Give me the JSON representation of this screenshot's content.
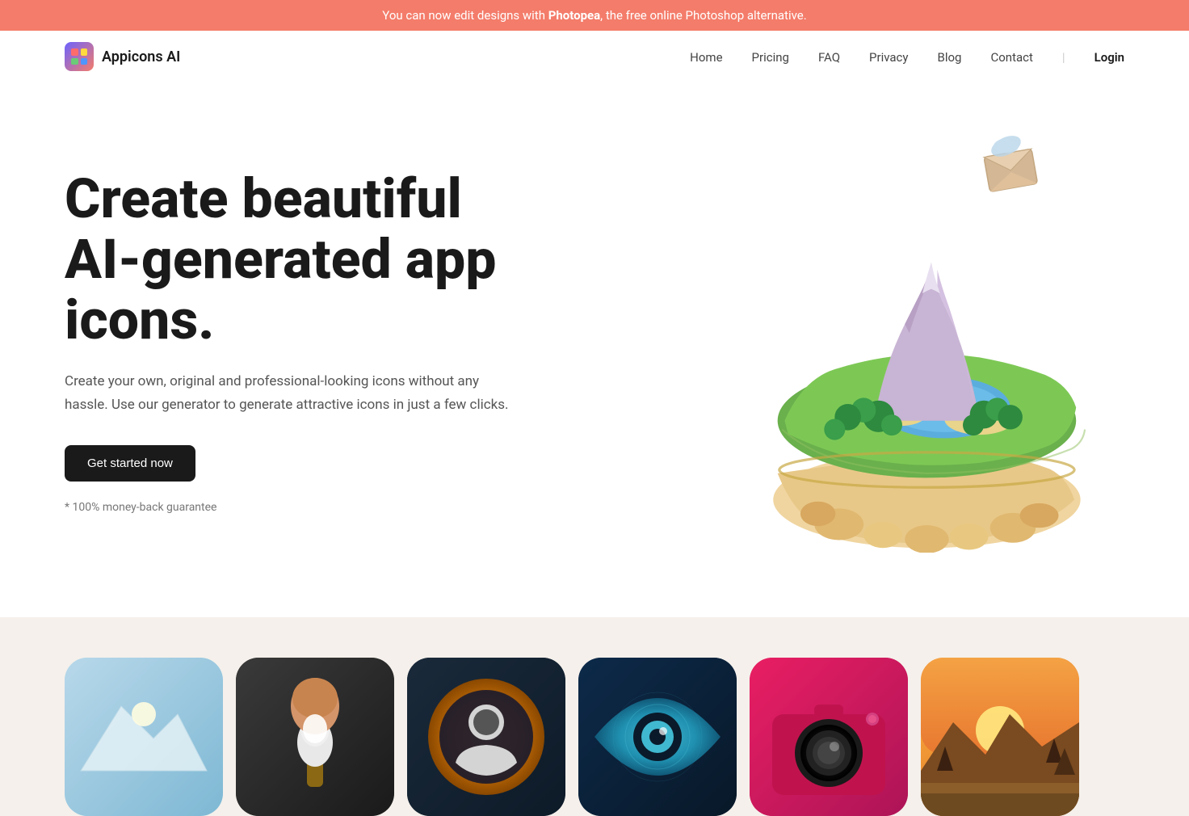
{
  "banner": {
    "text": "You can now edit designs with ",
    "highlight": "Photopea",
    "suffix": ", the free online Photoshop alternative."
  },
  "navbar": {
    "logo_text": "Appicons AI",
    "links": [
      {
        "label": "Home",
        "href": "#"
      },
      {
        "label": "Pricing",
        "href": "#"
      },
      {
        "label": "FAQ",
        "href": "#"
      },
      {
        "label": "Privacy",
        "href": "#"
      },
      {
        "label": "Blog",
        "href": "#"
      },
      {
        "label": "Contact",
        "href": "#"
      }
    ],
    "login_label": "Login"
  },
  "hero": {
    "title_line1": "Create beautiful",
    "title_line2": "AI-generated app icons.",
    "subtitle": "Create your own, original and professional-looking icons without any hassle. Use our generator to generate attractive icons in just a few clicks.",
    "cta_label": "Get started now",
    "guarantee": "* 100% money-back guarantee"
  },
  "app_icons": [
    {
      "id": "icon-1",
      "label": "App icon 1"
    },
    {
      "id": "icon-2",
      "label": "App icon 2"
    },
    {
      "id": "icon-3",
      "label": "App icon 3"
    },
    {
      "id": "icon-4",
      "label": "App icon 4"
    },
    {
      "id": "icon-5",
      "label": "App icon 5"
    },
    {
      "id": "icon-6",
      "label": "App icon 6"
    }
  ],
  "colors": {
    "banner_bg": "#f47c6a",
    "cta_bg": "#1a1a1a",
    "body_bg": "#ffffff",
    "bottom_bg": "#f5f0eb"
  }
}
